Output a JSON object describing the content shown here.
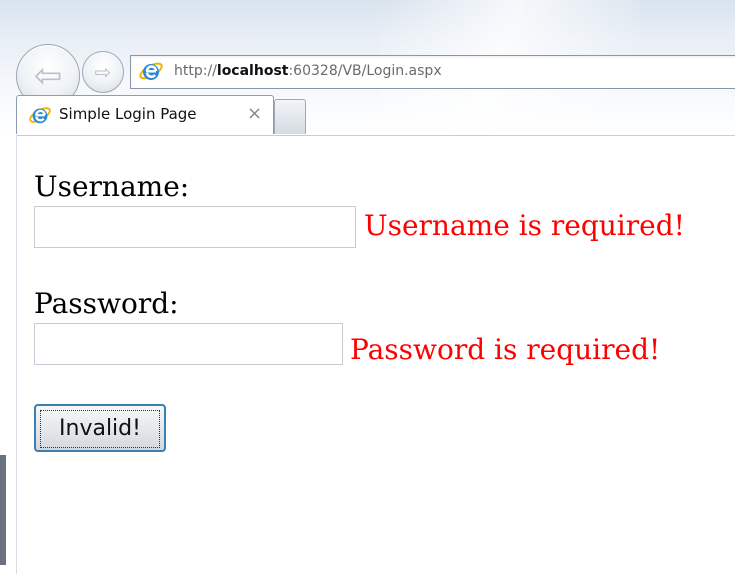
{
  "browser": {
    "url_prefix": "http://",
    "url_host": "localhost",
    "url_rest": ":60328/VB/Login.aspx",
    "tab_title": "Simple Login Page",
    "tab_close": "×"
  },
  "form": {
    "username_label": "Username:",
    "username_value": "",
    "username_error": "Username is required!",
    "password_label": "Password:",
    "password_value": "",
    "password_error": "Password is required!",
    "submit_label": "Invalid!"
  },
  "colors": {
    "error": "#ff0000",
    "button_border": "#3c7fb1"
  },
  "icons": {
    "back": "back-arrow-icon",
    "forward": "forward-arrow-icon",
    "site": "internet-explorer-icon",
    "tab_site": "internet-explorer-icon",
    "close": "close-icon"
  }
}
